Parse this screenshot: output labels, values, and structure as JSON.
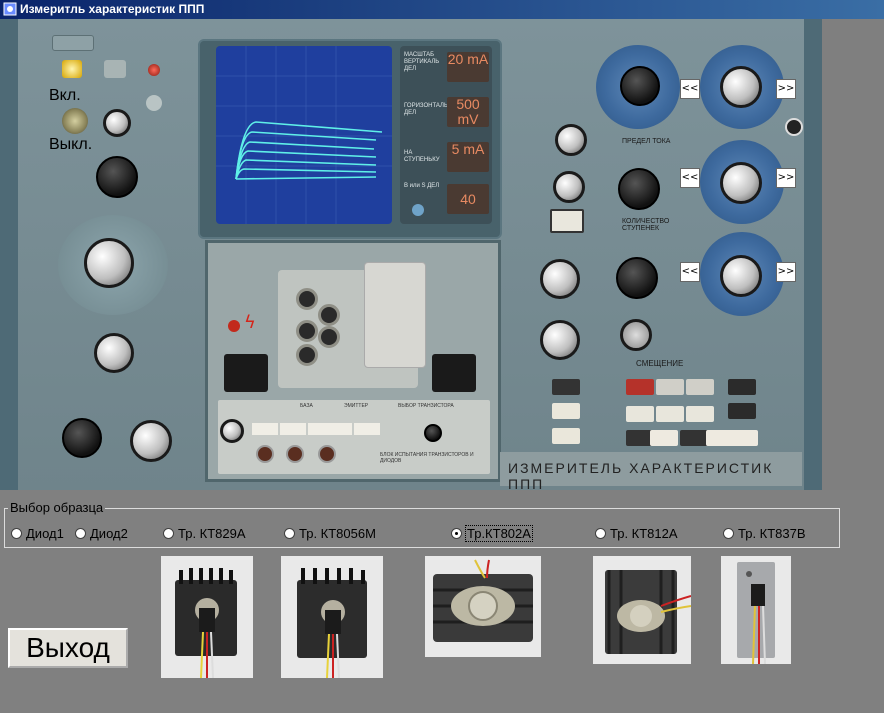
{
  "window": {
    "title": "Измеритль характеристик ППП"
  },
  "device": {
    "power_on_label": "Вкл.",
    "power_off_label": "Выкл.",
    "nameplate": "ИЗМЕРИТЕЛЬ ХАРАКТЕРИСТИК ППП",
    "readouts": [
      {
        "label": "МАСШТАБ ВЕРТИКАЛЬ ДЕЛ",
        "value": "20 mA"
      },
      {
        "label": "ГОРИЗОНТАЛЬ ДЕЛ",
        "value": "500 mV"
      },
      {
        "label": "НА СТУПЕНЬКУ",
        "value": "5 mA"
      },
      {
        "label": "В или S ДЕЛ",
        "value": "40"
      }
    ],
    "panel_labels": {
      "current_limit": "ПРЕДЕЛ ТОКА",
      "step_count": "КОЛИЧЕСТВО СТУПЕНЕК",
      "bias": "СМЕЩЕНИЕ",
      "base": "БАЗА",
      "emitter": "ЭМИТТЕР",
      "transistor_select": "ВЫБОР ТРАНЗИСТОРА",
      "test_block": "БЛОК ИСПЫТАНИЯ ТРАНЗИСТОРОВ И ДИОДОВ"
    },
    "nav_left_label": "<<",
    "nav_right_label": ">>"
  },
  "sample_selection": {
    "legend": "Выбор образца",
    "options": [
      {
        "label": "Диод1",
        "selected": false
      },
      {
        "label": "Диод2",
        "selected": false
      },
      {
        "label": "Тр. КТ829А",
        "selected": false
      },
      {
        "label": "Тр. КТ8056М",
        "selected": false
      },
      {
        "label": "Тр.КТ802А",
        "selected": true
      },
      {
        "label": "Тр. КТ812А",
        "selected": false
      },
      {
        "label": "Тр. КТ837В",
        "selected": false
      }
    ]
  },
  "exit_button": {
    "label": "Выход"
  },
  "colors": {
    "title_bar": "#0a246a",
    "screen": "#1f3f9e",
    "trace": "#5ff0e8",
    "background": "#808080"
  }
}
